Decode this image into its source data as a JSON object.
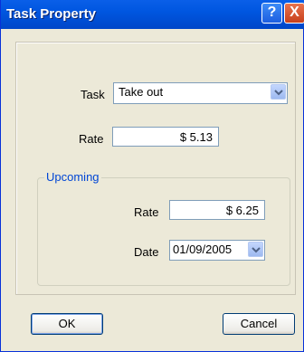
{
  "window": {
    "title": "Task Property",
    "help_label": "?",
    "close_label": "X"
  },
  "task": {
    "label": "Task",
    "value": "Take out"
  },
  "rate": {
    "label": "Rate",
    "value": "$ 5.13"
  },
  "upcoming": {
    "title": "Upcoming",
    "rate_label": "Rate",
    "rate_value": "$ 6.25",
    "date_label": "Date",
    "date_value": "01/09/2005"
  },
  "buttons": {
    "ok": "OK",
    "cancel": "Cancel"
  }
}
